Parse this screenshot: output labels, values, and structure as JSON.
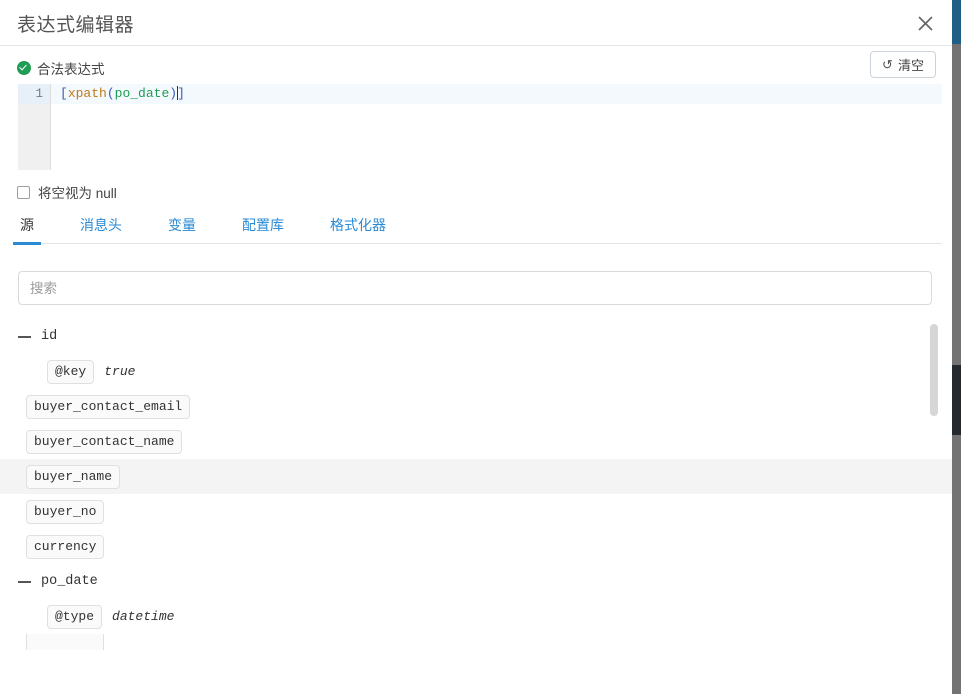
{
  "dialog": {
    "title": "表达式编辑器",
    "close_icon": "close-icon"
  },
  "validity": {
    "status_label": "合法表达式",
    "status_icon": "check-circle-icon",
    "status_color": "#1f9d55",
    "clear_button_label": "清空",
    "clear_button_icon": "undo-icon"
  },
  "editor": {
    "line_number": "1",
    "expression": "[xpath(po_date)]",
    "tokens": {
      "open_bracket": "[",
      "function_name": "xpath",
      "open_paren": "(",
      "argument": "po_date",
      "close_paren": ")",
      "close_bracket": "]"
    },
    "token_colors": {
      "bracket": "#3b5bb5",
      "function": "#c07818",
      "argument": "#1f9d55"
    },
    "active_line_bg": "#f4f9fd"
  },
  "options": {
    "treat_empty_as_null_label": "将空视为 null",
    "treat_empty_as_null_checked": false
  },
  "tabs": {
    "active_index": 0,
    "accent_color": "#2a8ad4",
    "items": [
      {
        "label": "源"
      },
      {
        "label": "消息头"
      },
      {
        "label": "变量"
      },
      {
        "label": "配置库"
      },
      {
        "label": "格式化器"
      }
    ]
  },
  "search": {
    "placeholder": "搜索",
    "value": ""
  },
  "tree": {
    "nodes": [
      {
        "type": "group",
        "name": "id",
        "expanded": true,
        "toggle_icon": "minus-icon"
      },
      {
        "type": "attribute",
        "key": "@key",
        "value": "true"
      },
      {
        "type": "field",
        "name": "buyer_contact_email",
        "highlighted": false
      },
      {
        "type": "field",
        "name": "buyer_contact_name",
        "highlighted": false
      },
      {
        "type": "field",
        "name": "buyer_name",
        "highlighted": true
      },
      {
        "type": "field",
        "name": "buyer_no",
        "highlighted": false
      },
      {
        "type": "field",
        "name": "currency",
        "highlighted": false
      },
      {
        "type": "group",
        "name": "po_date",
        "expanded": true,
        "toggle_icon": "minus-icon"
      },
      {
        "type": "attribute",
        "key": "@type",
        "value": "datetime"
      }
    ]
  }
}
